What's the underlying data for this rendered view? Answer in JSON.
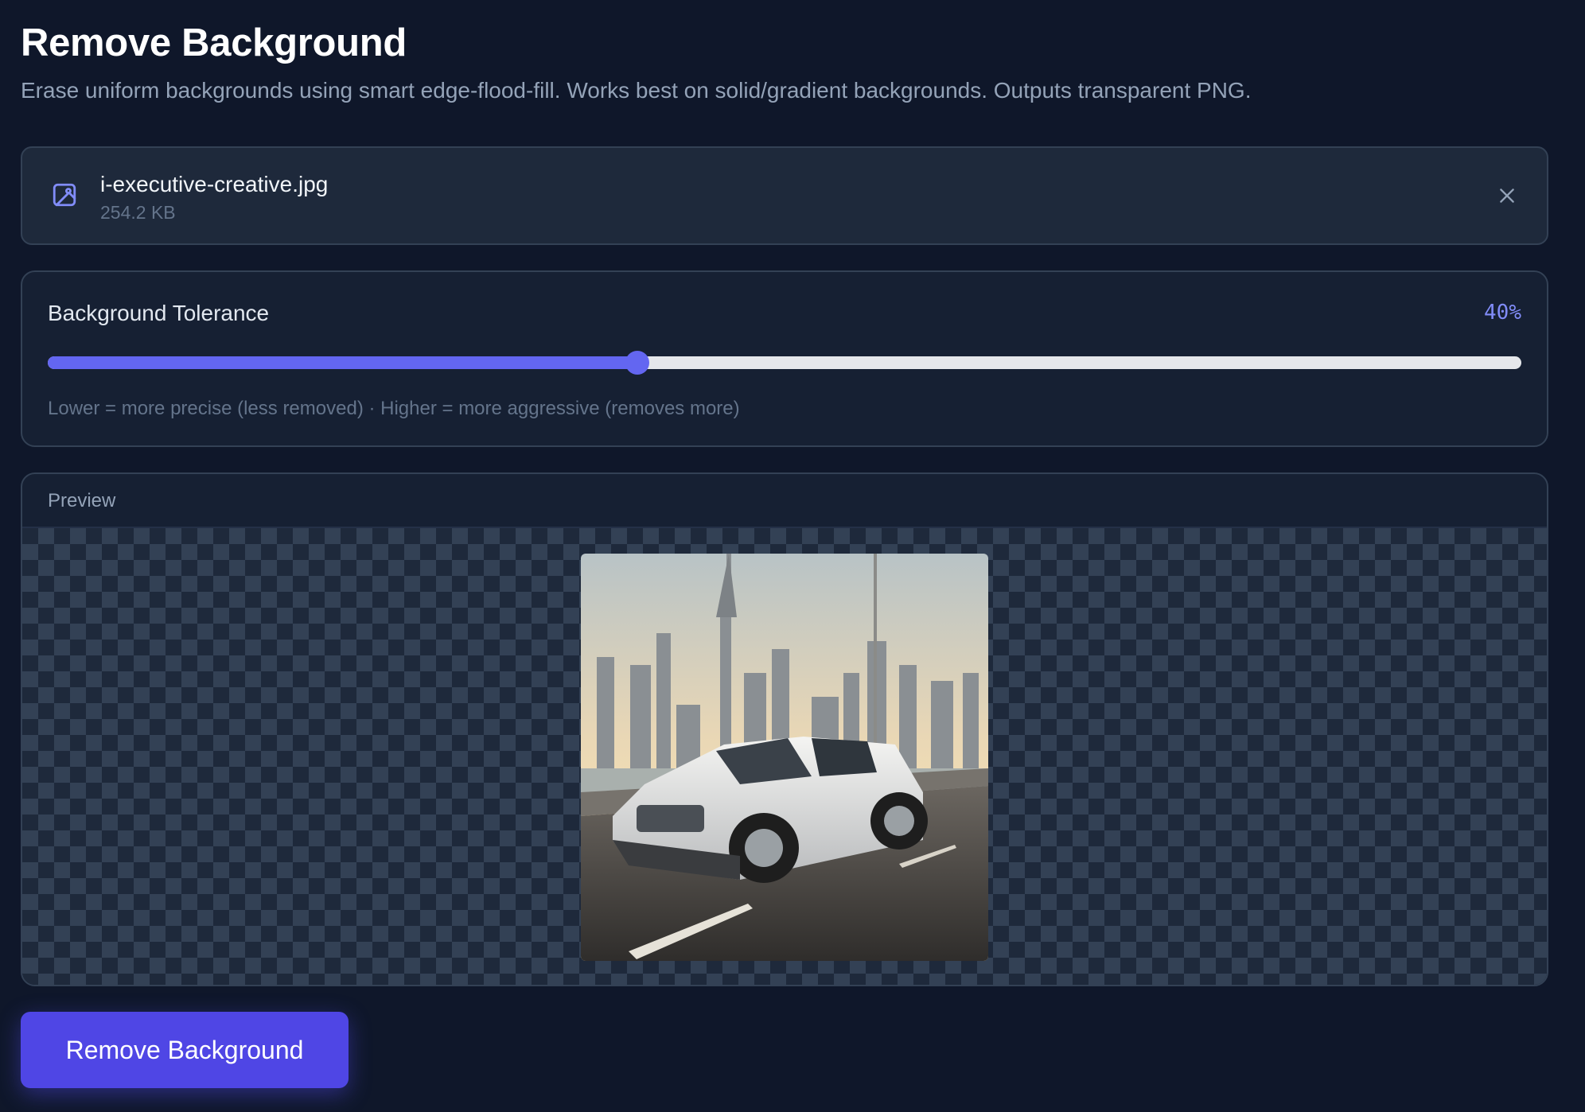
{
  "header": {
    "title": "Remove Background",
    "subtitle": "Erase uniform backgrounds using smart edge-flood-fill. Works best on solid/gradient backgrounds. Outputs transparent PNG."
  },
  "file": {
    "name": "i-executive-creative.jpg",
    "size": "254.2 KB",
    "icon": "image-icon",
    "close_icon": "close-icon"
  },
  "tolerance": {
    "label": "Background Tolerance",
    "value": 40,
    "value_text": "40%",
    "hint": "Lower = more precise (less removed) · Higher = more aggressive (removes more)"
  },
  "preview": {
    "label": "Preview"
  },
  "actions": {
    "remove_label": "Remove Background"
  },
  "colors": {
    "accent": "#6366f1",
    "button": "#4f46e5",
    "background": "#0f172a"
  }
}
